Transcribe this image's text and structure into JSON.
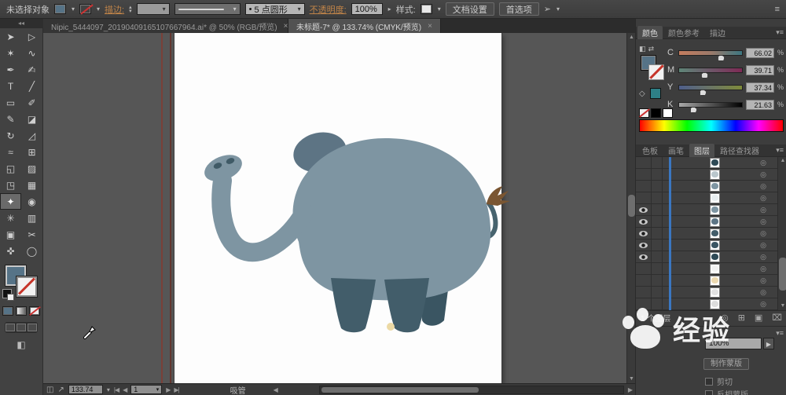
{
  "control_bar": {
    "selection_status": "未选择对象",
    "stroke_label": "描边:",
    "brush_bullet": "•",
    "brush_definition": "5 点圆形",
    "opacity_label": "不透明度:",
    "opacity_value": "100%",
    "style_label": "样式:",
    "document_setup_button": "文档设置",
    "preferences_button": "首选项"
  },
  "tab_bar": {
    "tabs": [
      {
        "title": "Nipic_5444097_20190409165107667964.ai* @ 50% (RGB/预览)",
        "close": "×",
        "active": false
      },
      {
        "title": "未标题-7* @ 133.74% (CMYK/预览)",
        "close": "×",
        "active": true
      }
    ]
  },
  "toolbar": {
    "tools": [
      {
        "name": "selection-tool",
        "glyph": "➤"
      },
      {
        "name": "direct-selection-tool",
        "glyph": "▷"
      },
      {
        "name": "magic-wand-tool",
        "glyph": "✶"
      },
      {
        "name": "lasso-tool",
        "glyph": "∿"
      },
      {
        "name": "pen-tool",
        "glyph": "✒"
      },
      {
        "name": "curvature-tool",
        "glyph": "✍"
      },
      {
        "name": "type-tool",
        "glyph": "T"
      },
      {
        "name": "line-segment-tool",
        "glyph": "╱"
      },
      {
        "name": "rectangle-tool",
        "glyph": "▭"
      },
      {
        "name": "paintbrush-tool",
        "glyph": "✐"
      },
      {
        "name": "pencil-tool",
        "glyph": "✎"
      },
      {
        "name": "eraser-tool",
        "glyph": "◪"
      },
      {
        "name": "rotate-tool",
        "glyph": "↻"
      },
      {
        "name": "scale-tool",
        "glyph": "◿"
      },
      {
        "name": "width-tool",
        "glyph": "≈"
      },
      {
        "name": "free-transform-tool",
        "glyph": "⊞"
      },
      {
        "name": "shape-builder-tool",
        "glyph": "◱"
      },
      {
        "name": "live-paint-bucket-tool",
        "glyph": "▨"
      },
      {
        "name": "perspective-grid-tool",
        "glyph": "◳"
      },
      {
        "name": "mesh-tool",
        "glyph": "▦"
      },
      {
        "name": "eyedropper-tool",
        "glyph": "✦",
        "selected": true
      },
      {
        "name": "blend-tool",
        "glyph": "◉"
      },
      {
        "name": "symbol-sprayer-tool",
        "glyph": "✳"
      },
      {
        "name": "graph-tool",
        "glyph": "▥"
      },
      {
        "name": "artboard-tool",
        "glyph": "▣"
      },
      {
        "name": "slice-tool",
        "glyph": "✂"
      },
      {
        "name": "hand-tool",
        "glyph": "✜"
      },
      {
        "name": "zoom-tool",
        "glyph": "◯"
      }
    ]
  },
  "color_panel": {
    "tabs": [
      {
        "label": "颜色",
        "active": true
      },
      {
        "label": "颜色参考",
        "active": false
      },
      {
        "label": "描边",
        "active": false
      }
    ],
    "sliders": [
      {
        "channel": "C",
        "value": "66.02",
        "percent": 66
      },
      {
        "channel": "M",
        "value": "39.71",
        "percent": 40
      },
      {
        "channel": "Y",
        "value": "37.34",
        "percent": 37
      },
      {
        "channel": "K",
        "value": "21.63",
        "percent": 22
      }
    ],
    "unit": "%"
  },
  "middle_panel": {
    "tabs": [
      {
        "label": "色板",
        "active": false
      },
      {
        "label": "画笔",
        "active": false
      },
      {
        "label": "图层",
        "active": true
      },
      {
        "label": "路径查找器",
        "active": false
      }
    ]
  },
  "layers_panel": {
    "footer_status": "1 个图层",
    "rows": [
      {
        "eye": false,
        "mark": "#2f4a56"
      },
      {
        "eye": false,
        "mark": "#b9c6cc"
      },
      {
        "eye": false,
        "mark": "#7e95a2"
      },
      {
        "eye": false,
        "mark": "#e8eef0"
      },
      {
        "eye": true,
        "mark": "#7e95a2"
      },
      {
        "eye": true,
        "mark": "#5d7585"
      },
      {
        "eye": true,
        "mark": "#425d6a"
      },
      {
        "eye": true,
        "mark": "#3a5563"
      },
      {
        "eye": true,
        "mark": "#2f4a56"
      },
      {
        "eye": false,
        "mark": "#f2f2f2"
      },
      {
        "eye": false,
        "mark": "#ecd9b0"
      },
      {
        "eye": false,
        "mark": "#e3e3e3"
      },
      {
        "eye": false,
        "mark": "#dddddd"
      }
    ]
  },
  "transparency_panel": {
    "opacity_value": "100%",
    "make_mask_button": "制作蒙版",
    "clip_label": "剪切",
    "invert_mask_label": "反相蒙版"
  },
  "status_bar": {
    "zoom_value": "133.74",
    "artboard_value": "1",
    "tool_name": "吸管"
  },
  "watermark_text": "经验",
  "elephant": {
    "body_color": "#7e95a2",
    "ear_color": "#5d7484",
    "leg_color": "#425d6a",
    "dark_color": "#3a5562",
    "nostril_color": "#3f5a66",
    "tail_color": "#47636e",
    "tail_tassel_color": "#7a5632",
    "dot_color": "#ecd9a4"
  },
  "colors": {
    "fill_swatch": "#567387",
    "layer_selection_blue": "#3a77c2",
    "link_orange": "#c08449",
    "guide_red": "#7a4038"
  },
  "icons": {
    "dropdown": "▾",
    "right_small": "▸",
    "stepper_up": "▴",
    "stepper_down": "▾",
    "up_arrow": "▲",
    "down_arrow": "▼",
    "left_arrow": "◀",
    "right_arrow": "▶",
    "nav_first": "|◀",
    "nav_prev": "◀",
    "nav_next": "▶",
    "nav_last": "▶|",
    "menu": "≡",
    "collapse": "◂◂",
    "target": "◎",
    "swap": "⇄",
    "proxy_tiny": "◧",
    "cube": "◇",
    "screen_mode": "◧",
    "select_similar": "➢",
    "status_collect": "◫",
    "status_export": "↗",
    "footer_clip": "◎",
    "footer_sublayer": "⊞",
    "footer_new": "▣",
    "footer_trash": "⌧"
  }
}
